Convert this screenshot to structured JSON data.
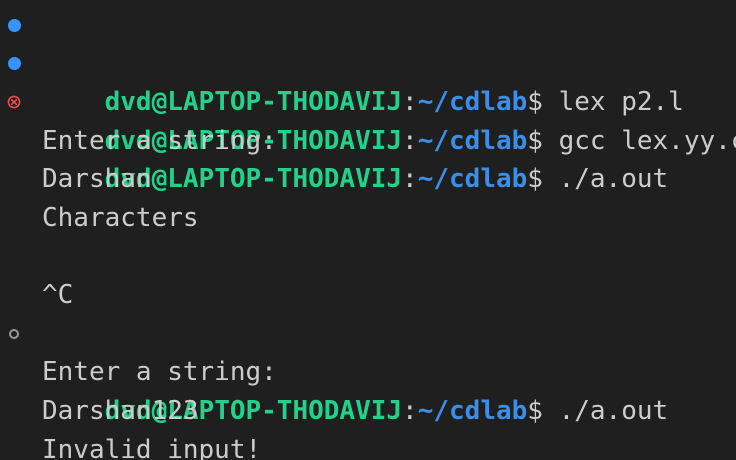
{
  "terminal": {
    "colors": {
      "background": "#1f1f1f",
      "text": "#cccccc",
      "user": "#23d18b",
      "path": "#3b8eea",
      "decoration_success": "#3794ff",
      "decoration_error": "#f14c4c",
      "decoration_pending": "#9a9a9a"
    },
    "prompt": {
      "user": "dvd@LAPTOP-THODAVIJ",
      "colon": ":",
      "path": "~/cdlab",
      "symbol": "$"
    },
    "lines": [
      {
        "command": " lex p2.l",
        "decoration": "success-dot-icon"
      },
      {
        "command": " gcc lex.yy.c",
        "decoration": "success-dot-icon"
      },
      {
        "command": " ./a.out",
        "decoration": "error-circle-x-icon"
      },
      {
        "output": "Enter a string:"
      },
      {
        "output": "Darshan"
      },
      {
        "output": "Characters"
      },
      {
        "output": ""
      },
      {
        "output": "^C"
      },
      {
        "command": " ./a.out",
        "decoration": "pending-circle-icon"
      },
      {
        "output": "Enter a string:"
      },
      {
        "output": "Darshan123"
      },
      {
        "output": "Invalid input!"
      }
    ]
  }
}
